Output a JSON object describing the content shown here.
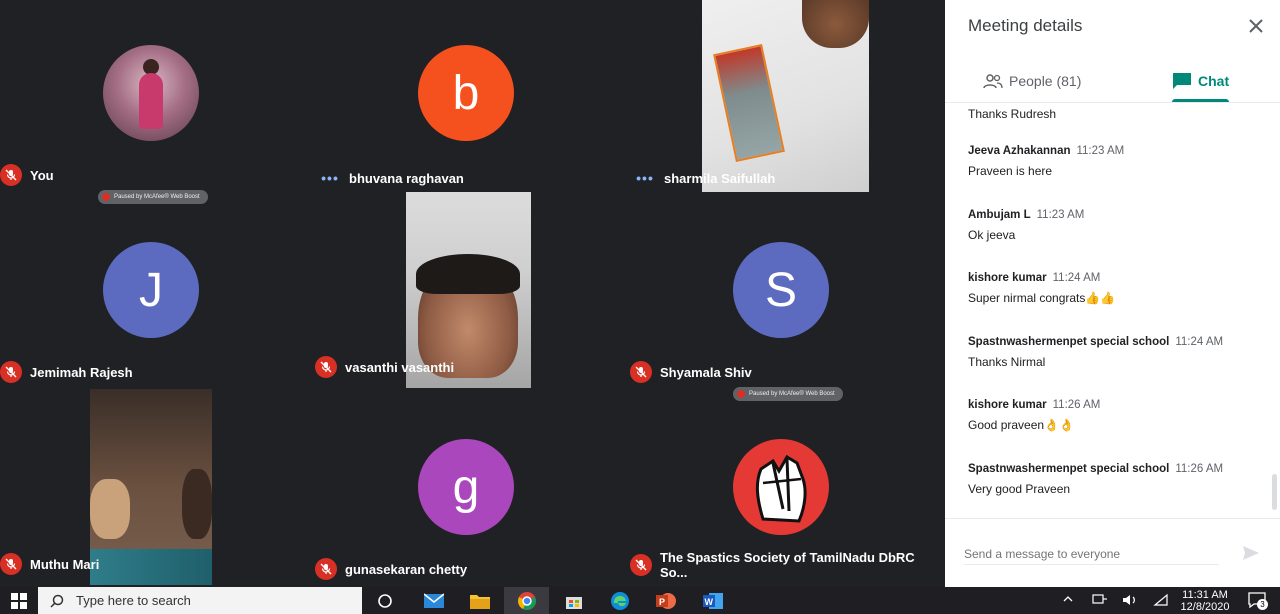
{
  "participants": [
    {
      "name": "You",
      "initial": "",
      "color": "",
      "muted": true
    },
    {
      "name": "bhuvana raghavan",
      "initial": "b",
      "color": "#f4511e",
      "muted": false
    },
    {
      "name": "sharmila Saifullah",
      "initial": "",
      "color": "",
      "muted": false
    },
    {
      "name": "Jemimah Rajesh",
      "initial": "J",
      "color": "#5c6bc0",
      "muted": true
    },
    {
      "name": "vasanthi vasanthi",
      "initial": "",
      "color": "",
      "muted": true
    },
    {
      "name": "Shyamala Shiv",
      "initial": "S",
      "color": "#5c6bc0",
      "muted": true
    },
    {
      "name": "Muthu Mari",
      "initial": "",
      "color": "",
      "muted": true
    },
    {
      "name": "gunasekaran chetty",
      "initial": "g",
      "color": "#ab47bc",
      "muted": true
    },
    {
      "name": "The Spastics Society of TamilNadu DbRC So...",
      "initial": "",
      "color": "",
      "muted": true
    }
  ],
  "paused_badge": "Paused by McAfee® Web Boost",
  "panel": {
    "title": "Meeting details",
    "tab_people": "People (81)",
    "tab_chat": "Chat",
    "messages": [
      {
        "sender": "",
        "time": "",
        "text": "Thanks Rudresh"
      },
      {
        "sender": "Jeeva Azhakannan",
        "time": "11:23 AM",
        "text": "Praveen  is here"
      },
      {
        "sender": "Ambujam L",
        "time": "11:23 AM",
        "text": "Ok jeeva"
      },
      {
        "sender": "kishore kumar",
        "time": "11:24 AM",
        "text": "Super nirmal congrats👍👍"
      },
      {
        "sender": "Spastnwashermenpet special school",
        "time": "11:24 AM",
        "text": "Thanks Nirmal"
      },
      {
        "sender": "kishore kumar",
        "time": "11:26 AM",
        "text": "Good praveen👌👌"
      },
      {
        "sender": "Spastnwashermenpet special school",
        "time": "11:26 AM",
        "text": "Very good Praveen"
      }
    ],
    "compose_placeholder": "Send a message to everyone"
  },
  "taskbar": {
    "search_placeholder": "Type here to search",
    "time": "11:31 AM",
    "date": "12/8/2020",
    "notification_count": "3"
  },
  "colors": {
    "chat_accent": "#00897b",
    "mute_red": "#d93025",
    "grid_bg": "#202124"
  }
}
